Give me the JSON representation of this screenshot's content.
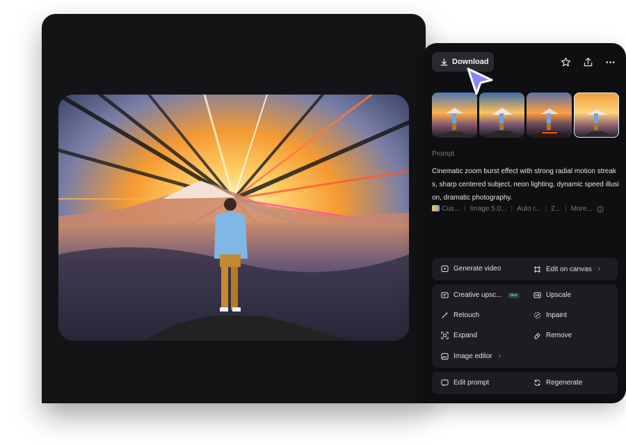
{
  "toolbar": {
    "download_label": "Download",
    "icons": [
      "download-icon",
      "star-icon",
      "share-icon",
      "more-icon"
    ]
  },
  "variations": [
    {
      "id": 1,
      "selected": false
    },
    {
      "id": 2,
      "selected": false
    },
    {
      "id": 3,
      "selected": false
    },
    {
      "id": 4,
      "selected": true
    }
  ],
  "prompt": {
    "label": "Prompt",
    "text": "Cinematic zoom burst effect with strong radial motion streaks, sharp centered subject, neon lighting, dynamic speed illusion, dramatic photography."
  },
  "meta": {
    "style": "Cus...",
    "model": "Image 5.0...",
    "ratio": "Auto r...",
    "count": "2...",
    "more": "More..."
  },
  "actions": {
    "generate_video": "Generate video",
    "edit_on_canvas": "Edit on canvas",
    "creative_upscale": "Creative upsc...",
    "new_badge": "New",
    "upscale": "Upscale",
    "retouch": "Retouch",
    "inpaint": "Inpaint",
    "expand": "Expand",
    "remove": "Remove",
    "image_editor": "Image editor",
    "edit_prompt": "Edit prompt",
    "regenerate": "Regenerate"
  },
  "colors": {
    "panel_bg": "#0f0f11",
    "group_bg": "#1d1d21",
    "cursor_accent": "#8b86f5"
  }
}
